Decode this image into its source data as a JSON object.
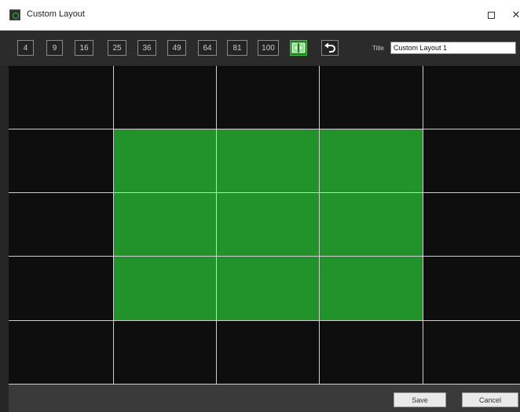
{
  "window": {
    "title": "Custom Layout",
    "maximize_icon": "maximize-icon",
    "close_glyph": "✕"
  },
  "toolbar": {
    "grid_presets": [
      "4",
      "9",
      "16",
      "25",
      "36",
      "49",
      "64",
      "81",
      "100"
    ],
    "merge_icon": "merge-cells-icon",
    "undo_icon": "undo-icon",
    "title_label": "Title",
    "title_value": "Custom Layout 1"
  },
  "layout": {
    "rows": 5,
    "columns": 5,
    "selected_cells": [
      [
        1,
        1
      ],
      [
        1,
        2
      ],
      [
        1,
        3
      ],
      [
        2,
        1
      ],
      [
        2,
        2
      ],
      [
        2,
        3
      ],
      [
        3,
        1
      ],
      [
        3,
        2
      ],
      [
        3,
        3
      ]
    ],
    "selected_color": "#22932a",
    "empty_color": "#0e0e0e",
    "grid_line_color": "#cfcfcf"
  },
  "footer": {
    "save_label": "Save",
    "cancel_label": "Cancel"
  }
}
